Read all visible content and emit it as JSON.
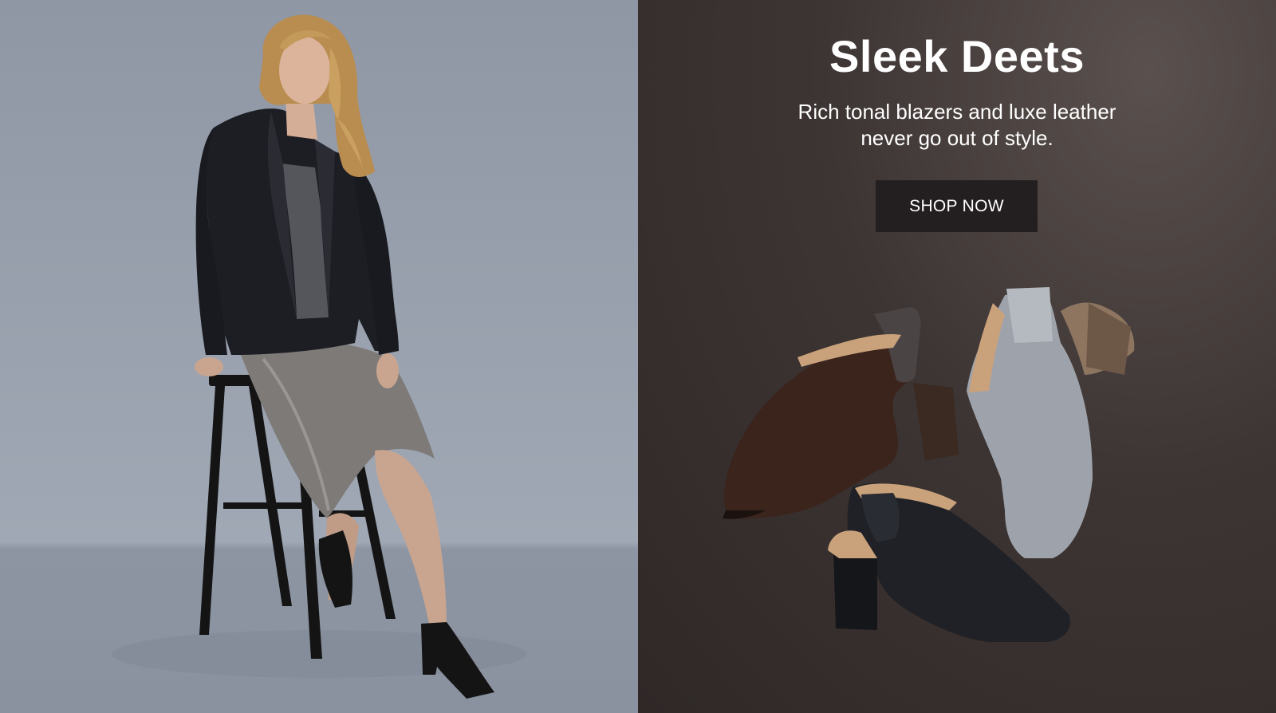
{
  "hero": {
    "headline": "Sleek Deets",
    "subcopy": "Rich tonal blazers and luxe leather never go out of style.",
    "cta_label": "SHOP NOW"
  },
  "colors": {
    "left_background": "#98a0ad",
    "right_background": "#3d3533",
    "cta_background": "#231f20",
    "text": "#ffffff"
  },
  "images": {
    "model_photo": "model-seated-on-stool",
    "shoes_photo": "three-peep-toe-block-heel-booties"
  }
}
